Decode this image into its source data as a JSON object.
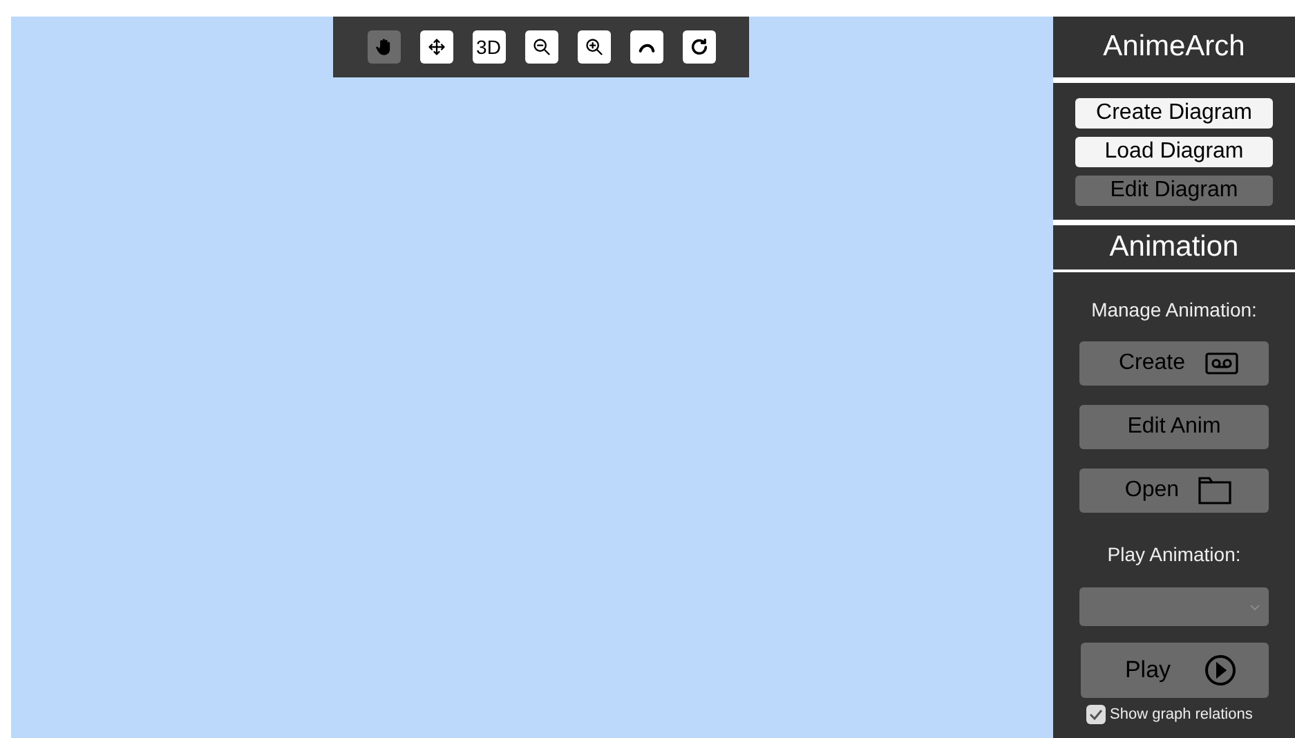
{
  "toolbar": {
    "tools": [
      {
        "kind": "hand",
        "selected": true
      },
      {
        "kind": "move",
        "selected": false
      },
      {
        "kind": "text",
        "label": "3D",
        "selected": false
      },
      {
        "kind": "zoom-out",
        "selected": false
      },
      {
        "kind": "zoom-in",
        "selected": false
      },
      {
        "kind": "curve",
        "selected": false
      },
      {
        "kind": "rotate",
        "selected": false
      }
    ]
  },
  "sidebar": {
    "title": "AnimeArch",
    "diagram_buttons": [
      {
        "label": "Create Diagram",
        "disabled": false
      },
      {
        "label": "Load Diagram",
        "disabled": false
      },
      {
        "label": "Edit Diagram",
        "disabled": true
      }
    ],
    "animation": {
      "title": "Animation",
      "manage_label": "Manage Animation:",
      "buttons": [
        {
          "label": "Create",
          "kind": "tape"
        },
        {
          "label": "Edit Anim",
          "kind": "none"
        },
        {
          "label": "Open",
          "kind": "folder"
        }
      ],
      "play_label": "Play Animation:",
      "play_button": "Play",
      "show_relations": {
        "label": "Show graph relations",
        "checked": true
      }
    }
  }
}
